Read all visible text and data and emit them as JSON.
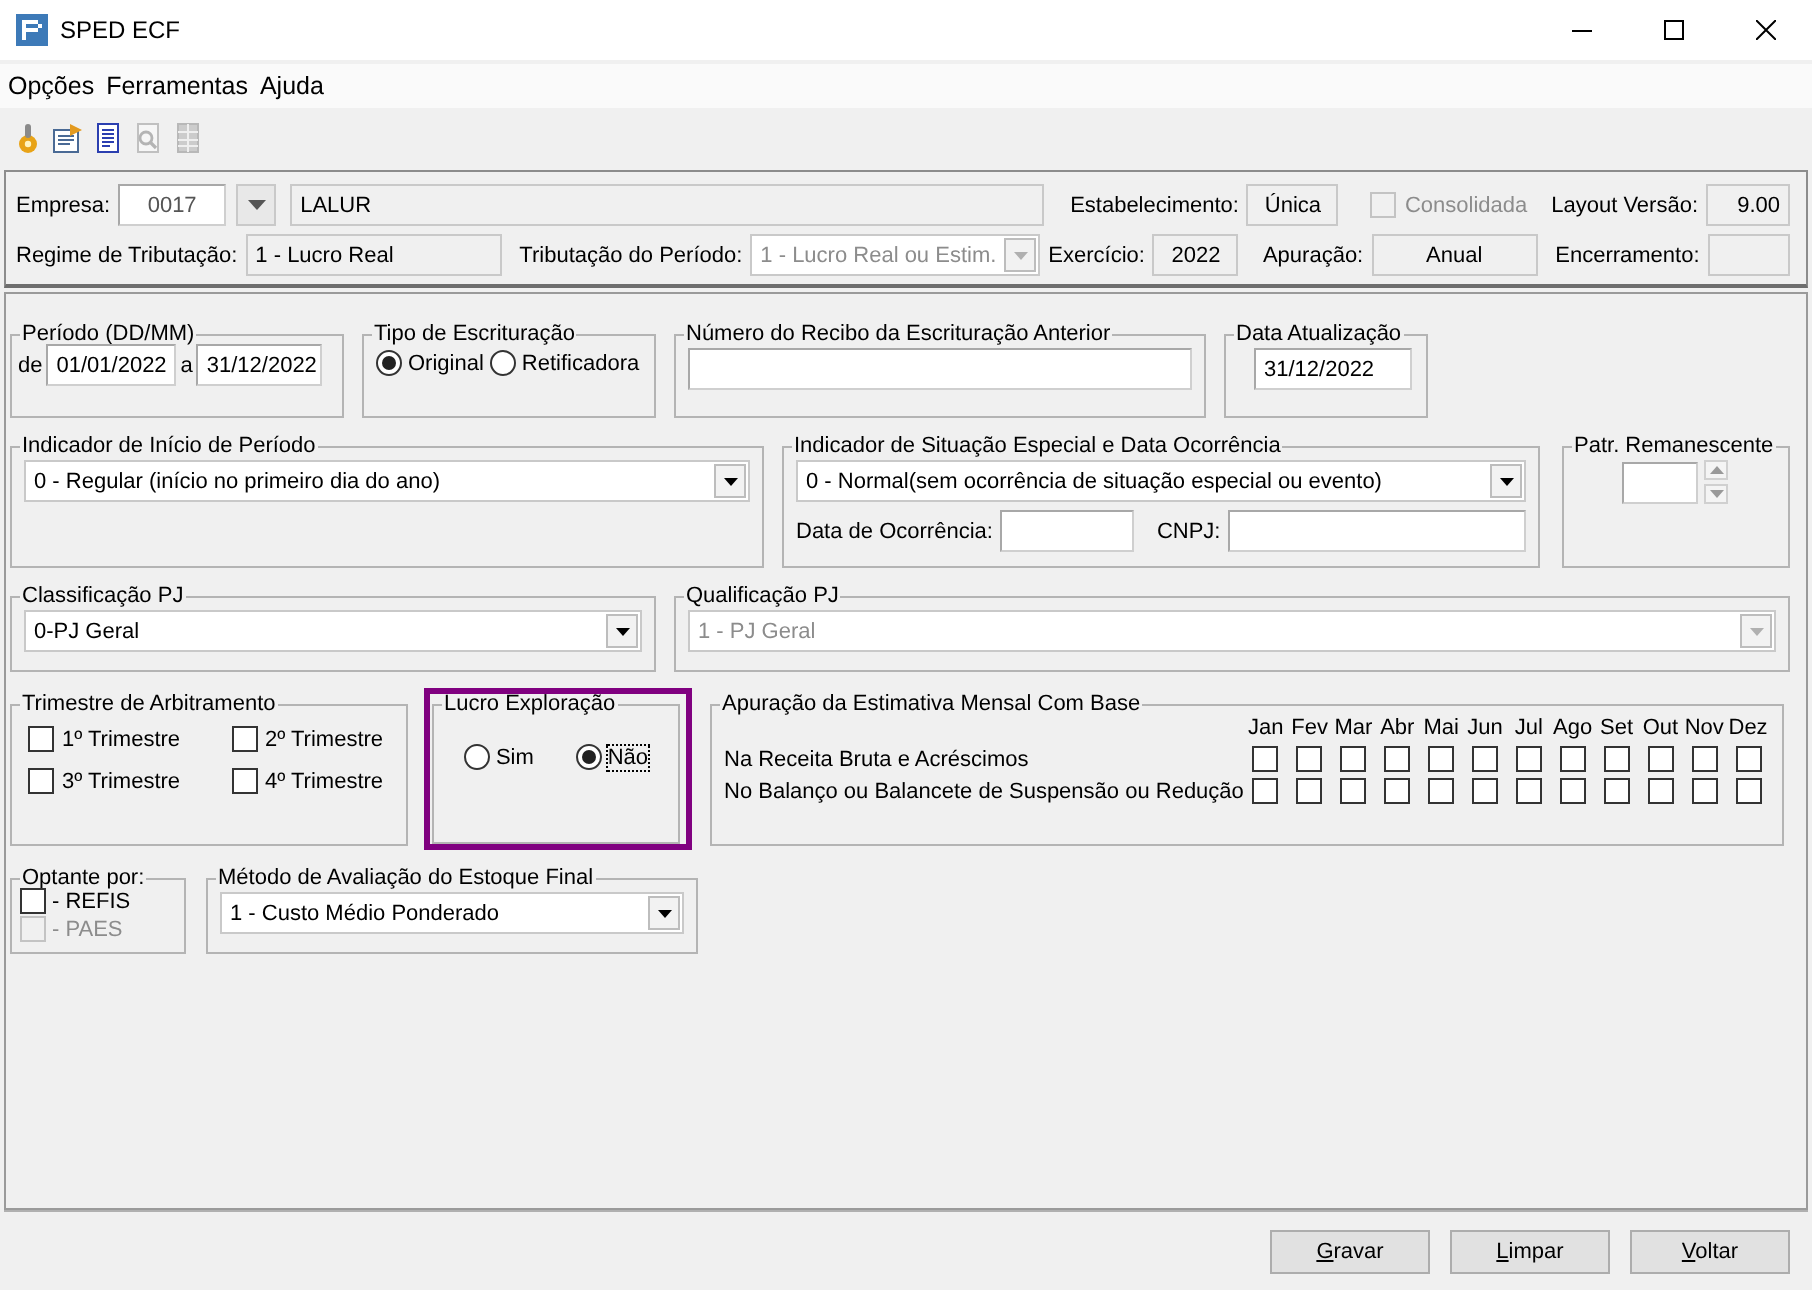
{
  "window": {
    "title": "SPED ECF"
  },
  "menu": [
    {
      "label": "Opções"
    },
    {
      "label": "Ferramentas"
    },
    {
      "label": "Ajuda"
    }
  ],
  "toolbar": [
    {
      "kind": "gear",
      "disabled": false
    },
    {
      "kind": "form",
      "disabled": false
    },
    {
      "kind": "document",
      "disabled": false
    },
    {
      "kind": "preview",
      "disabled": true
    },
    {
      "kind": "table",
      "disabled": true
    }
  ],
  "header": {
    "empresa_label": "Empresa:",
    "empresa_code": "0017",
    "empresa_name": "LALUR",
    "estabelecimento_label": "Estabelecimento:",
    "estabelecimento": "Única",
    "consolidada": {
      "label": "Consolidada",
      "checked": false,
      "disabled": true
    },
    "layout_label": "Layout Versão:",
    "layout": "9.00",
    "regime_label": "Regime de Tributação:",
    "regime": "1 - Lucro Real",
    "tributacao_label": "Tributação do Período:",
    "tributacao": {
      "value": "1 - Lucro Real ou Estim.",
      "disabled": true
    },
    "exercicio_label": "Exercício:",
    "exercicio": "2022",
    "apuracao_label": "Apuração:",
    "apuracao": "Anual",
    "encerramento_label": "Encerramento:"
  },
  "periodo": {
    "title": "Período (DD/MM)",
    "from_label": "de",
    "from": "01/01/2022",
    "to_label": "a",
    "to": "31/12/2022"
  },
  "tipo_escrituracao": {
    "title": "Tipo de Escrituração",
    "options": [
      {
        "label": "Original",
        "selected": true
      },
      {
        "label": "Retificadora",
        "selected": false
      }
    ]
  },
  "recibo_anterior": {
    "title": "Número do Recibo da Escrituração Anterior"
  },
  "data_atualizacao": {
    "title": "Data Atualização",
    "value": "31/12/2022"
  },
  "inicio_periodo": {
    "title": "Indicador de Início de Período",
    "value": "0 - Regular (início no primeiro dia do ano)",
    "disabled": false
  },
  "situacao_especial": {
    "title": "Indicador de Situação Especial e Data Ocorrência",
    "value": "0 - Normal(sem ocorrência de situação especial ou evento)",
    "disabled": false,
    "data_label": "Data de Ocorrência:",
    "cnpj_label": "CNPJ:"
  },
  "patr_remanescente": {
    "title": "Patr. Remanescente"
  },
  "classificacao_pj": {
    "title": "Classificação PJ",
    "value": "0-PJ Geral",
    "disabled": false
  },
  "qualificacao_pj": {
    "title": "Qualificação PJ",
    "value": "1 - PJ Geral",
    "disabled": true
  },
  "trimestre": {
    "title": "Trimestre de Arbitramento",
    "items": [
      {
        "label": "1º Trimestre",
        "checked": false
      },
      {
        "label": "2º Trimestre",
        "checked": false
      },
      {
        "label": "3º Trimestre",
        "checked": false
      },
      {
        "label": "4º Trimestre",
        "checked": false
      }
    ]
  },
  "lucro_exploracao": {
    "title": "Lucro Exploração",
    "highlighted": true,
    "options": [
      {
        "label": "Sim",
        "selected": false,
        "focused": false
      },
      {
        "label": "Não",
        "selected": true,
        "focused": true
      }
    ]
  },
  "estimativa": {
    "title": "Apuração da Estimativa Mensal Com Base",
    "months": [
      "Jan",
      "Fev",
      "Mar",
      "Abr",
      "Mai",
      "Jun",
      "Jul",
      "Ago",
      "Set",
      "Out",
      "Nov",
      "Dez"
    ],
    "rows": [
      {
        "label": "Na Receita Bruta e Acréscimos",
        "checked": [
          false,
          false,
          false,
          false,
          false,
          false,
          false,
          false,
          false,
          false,
          false,
          false
        ]
      },
      {
        "label": "No Balanço ou Balancete de Suspensão ou Redução",
        "checked": [
          false,
          false,
          false,
          false,
          false,
          false,
          false,
          false,
          false,
          false,
          false,
          false
        ]
      }
    ]
  },
  "optante": {
    "title": "Optante por:",
    "items": [
      {
        "label": "- REFIS",
        "checked": false,
        "disabled": false
      },
      {
        "label": "- PAES",
        "checked": false,
        "disabled": true
      }
    ]
  },
  "metodo_estoque": {
    "title": "Método de Avaliação do Estoque Final",
    "value": "1 - Custo Médio Ponderado",
    "disabled": false
  },
  "buttons": [
    {
      "label": "Gravar"
    },
    {
      "label": "Limpar"
    },
    {
      "label": "Voltar"
    }
  ]
}
